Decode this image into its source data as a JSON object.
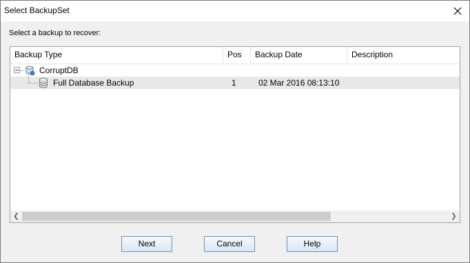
{
  "window": {
    "title": "Select BackupSet",
    "close_icon": "close-icon"
  },
  "prompt": "Select a backup to recover:",
  "grid": {
    "columns": [
      "Backup Type",
      "Pos",
      "Backup Date",
      "Description"
    ],
    "root": {
      "label": "CorruptDB",
      "expanded": true,
      "icon": "database-server-icon"
    },
    "rows": [
      {
        "type": "Full Database Backup",
        "pos": "1",
        "date": "02 Mar 2016 08:13:10",
        "description": "",
        "icon": "database-backup-icon",
        "selected": true
      }
    ]
  },
  "buttons": {
    "next": "Next",
    "cancel": "Cancel",
    "help": "Help"
  },
  "colors": {
    "selection": "#e8e8e8",
    "button_border": "#6d8fbf"
  }
}
